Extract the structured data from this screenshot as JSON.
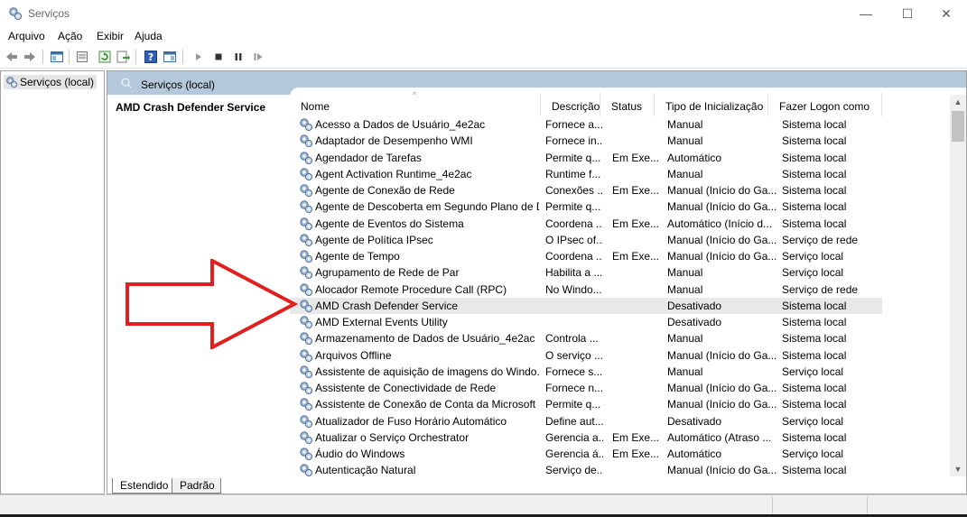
{
  "window": {
    "title": "Serviços",
    "minimize_glyph": "—",
    "maximize_glyph": "☐",
    "close_glyph": "✕"
  },
  "menu": [
    "Arquivo",
    "Ação",
    "Exibir",
    "Ajuda"
  ],
  "toolbar_icons": [
    "back-arrow-icon",
    "forward-arrow-icon",
    "console-tree-icon",
    "properties-icon",
    "refresh-icon",
    "export-list-icon",
    "help-icon",
    "show-hide-pane-icon",
    "play-icon",
    "stop-icon",
    "pause-icon",
    "resume-icon"
  ],
  "tree": {
    "item": "Serviços (local)"
  },
  "pane": {
    "header": "Serviços (local)",
    "selected_service": "AMD Crash Defender Service"
  },
  "columns": [
    "Nome",
    "Descrição",
    "Status",
    "Tipo de Inicialização",
    "Fazer Logon como"
  ],
  "rows": [
    [
      "Acesso a Dados de Usuário_4e2ac",
      "Fornece a...",
      "",
      "Manual",
      "Sistema local"
    ],
    [
      "Adaptador de Desempenho WMI",
      "Fornece in...",
      "",
      "Manual",
      "Sistema local"
    ],
    [
      "Agendador de Tarefas",
      "Permite q...",
      "Em Exe...",
      "Automático",
      "Sistema local"
    ],
    [
      "Agent Activation Runtime_4e2ac",
      "Runtime f...",
      "",
      "Manual",
      "Sistema local"
    ],
    [
      "Agente de Conexão de Rede",
      "Conexões ...",
      "Em Exe...",
      "Manual (Início do Ga...",
      "Sistema local"
    ],
    [
      "Agente de Descoberta em Segundo Plano de D...",
      "Permite q...",
      "",
      "Manual (Início do Ga...",
      "Sistema local"
    ],
    [
      "Agente de Eventos do Sistema",
      "Coordena ...",
      "Em Exe...",
      "Automático (Início d...",
      "Sistema local"
    ],
    [
      "Agente de Política IPsec",
      "O IPsec of...",
      "",
      "Manual (Início do Ga...",
      "Serviço de rede"
    ],
    [
      "Agente de Tempo",
      "Coordena ...",
      "Em Exe...",
      "Manual (Início do Ga...",
      "Serviço local"
    ],
    [
      "Agrupamento de Rede de Par",
      "Habilita a ...",
      "",
      "Manual",
      "Serviço local"
    ],
    [
      "Alocador Remote Procedure Call (RPC)",
      "No Windo...",
      "",
      "Manual",
      "Serviço de rede"
    ],
    [
      "AMD Crash Defender Service",
      "",
      "",
      "Desativado",
      "Sistema local"
    ],
    [
      "AMD External Events Utility",
      "",
      "",
      "Desativado",
      "Sistema local"
    ],
    [
      "Armazenamento de Dados de Usuário_4e2ac",
      "Controla ...",
      "",
      "Manual",
      "Sistema local"
    ],
    [
      "Arquivos Offline",
      "O serviço ...",
      "",
      "Manual (Início do Ga...",
      "Sistema local"
    ],
    [
      "Assistente de aquisição de imagens do Windo...",
      "Fornece s...",
      "",
      "Manual",
      "Serviço local"
    ],
    [
      "Assistente de Conectividade de Rede",
      "Fornece n...",
      "",
      "Manual (Início do Ga...",
      "Sistema local"
    ],
    [
      "Assistente de Conexão de Conta da Microsoft",
      "Permite q...",
      "",
      "Manual (Início do Ga...",
      "Sistema local"
    ],
    [
      "Atualizador de Fuso Horário Automático",
      "Define aut...",
      "",
      "Desativado",
      "Serviço local"
    ],
    [
      "Atualizar o Serviço Orchestrator",
      "Gerencia a...",
      "Em Exe...",
      "Automático (Atraso ...",
      "Sistema local"
    ],
    [
      "Áudio do Windows",
      "Gerencia á...",
      "Em Exe...",
      "Automático",
      "Serviço local"
    ],
    [
      "Autenticação Natural",
      "Serviço de...",
      "",
      "Manual (Início do Ga...",
      "Sistema local"
    ]
  ],
  "selected_row": 11,
  "tabs": [
    "Estendido",
    "Padrão"
  ],
  "colors": {
    "header_band": "#b4c8dc",
    "selection": "#e8e8e8",
    "arrow": "#e01f1f"
  }
}
